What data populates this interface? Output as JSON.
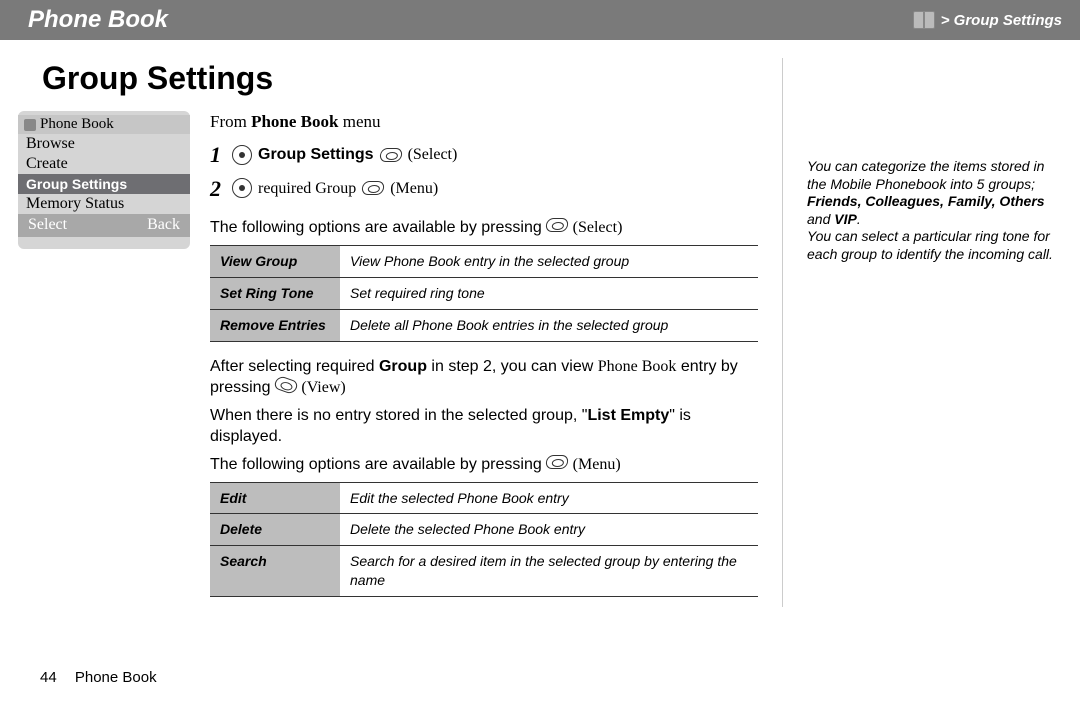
{
  "header": {
    "title": "Phone Book",
    "crumb": "> Group Settings"
  },
  "section_title": "Group Settings",
  "phone_screenshot": {
    "title": "Phone Book",
    "items": [
      "Browse",
      "Create",
      "Group Settings",
      "Memory Status"
    ],
    "selected_index": 2,
    "softkeys": {
      "left": "Select",
      "right": "Back"
    }
  },
  "instructions": {
    "from_prefix": "From ",
    "from_bold": "Phone Book",
    "from_suffix": " menu",
    "steps": [
      {
        "num": "1",
        "bold": "Group Settings",
        "after": " (Select)"
      },
      {
        "num": "2",
        "plain": "required Group",
        "after": " (Menu)"
      }
    ],
    "avail_line_prefix": "The following options are available by pressing ",
    "avail_line_suffix": " (Select)",
    "avail_line2_suffix": " (Menu)"
  },
  "options_table1": [
    {
      "name": "View Group",
      "desc": "View Phone Book entry in the selected group"
    },
    {
      "name": "Set Ring Tone",
      "desc": "Set required ring tone"
    },
    {
      "name": "Remove Entries",
      "desc": "Delete all Phone Book entries in the selected group"
    }
  ],
  "mid_para": {
    "p1a": "After selecting required ",
    "p1b": "Group",
    "p1c": " in step 2, you can view ",
    "p1d": "Phone Book",
    "p1e": " entry by pressing ",
    "p1f": " (View)",
    "p2a": "When there is no entry stored in the selected group, \"",
    "p2b": "List Empty",
    "p2c": "\" is displayed."
  },
  "options_table2": [
    {
      "name": "Edit",
      "desc": "Edit the selected Phone Book entry"
    },
    {
      "name": "Delete",
      "desc": "Delete the selected Phone Book entry"
    },
    {
      "name": "Search",
      "desc": "Search for a desired item in the selected group by entering the name"
    }
  ],
  "sidebar": {
    "s1": "You can categorize the items stored in the Mobile Phonebook into 5 groups; ",
    "groups": "Friends, Colleagues, Family, Others",
    "and": " and ",
    "vip": "VIP",
    "dot": ".",
    "s2": "You can select a particular ring tone for each group to identify the incoming call."
  },
  "footer": {
    "page_num": "44",
    "chapter": "Phone Book"
  }
}
